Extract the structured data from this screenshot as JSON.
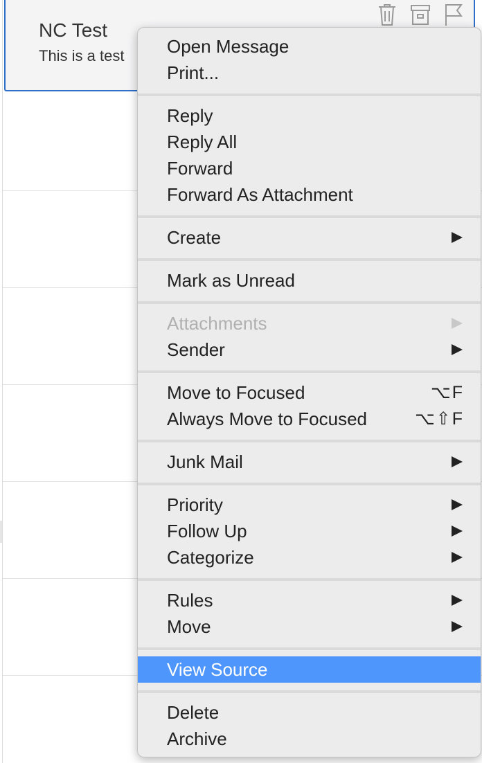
{
  "message": {
    "sender": "NC Test",
    "preview": "This is a test",
    "actions": [
      "trash-icon",
      "archive-icon",
      "flag-icon"
    ]
  },
  "colors": {
    "highlight": "#4e96fb",
    "selected_border": "#2f6fc9",
    "menu_background": "#ececec",
    "disabled_text": "#b0b0b0"
  },
  "menu": {
    "groups": [
      {
        "items": [
          {
            "label": "Open Message"
          },
          {
            "label": "Print..."
          }
        ]
      },
      {
        "items": [
          {
            "label": "Reply"
          },
          {
            "label": "Reply All"
          },
          {
            "label": "Forward"
          },
          {
            "label": "Forward As Attachment"
          }
        ]
      },
      {
        "items": [
          {
            "label": "Create",
            "submenu": true
          }
        ]
      },
      {
        "items": [
          {
            "label": "Mark as Unread"
          }
        ]
      },
      {
        "items": [
          {
            "label": "Attachments",
            "submenu": true,
            "disabled": true
          },
          {
            "label": "Sender",
            "submenu": true
          }
        ]
      },
      {
        "items": [
          {
            "label": "Move to Focused",
            "shortcut": "⌥F"
          },
          {
            "label": "Always Move to Focused",
            "shortcut": "⌥⇧F"
          }
        ]
      },
      {
        "items": [
          {
            "label": "Junk Mail",
            "submenu": true
          }
        ]
      },
      {
        "items": [
          {
            "label": "Priority",
            "submenu": true
          },
          {
            "label": "Follow Up",
            "submenu": true
          },
          {
            "label": "Categorize",
            "submenu": true
          }
        ]
      },
      {
        "items": [
          {
            "label": "Rules",
            "submenu": true
          },
          {
            "label": "Move",
            "submenu": true
          }
        ]
      },
      {
        "items": [
          {
            "label": "View Source",
            "highlighted": true
          }
        ]
      },
      {
        "items": [
          {
            "label": "Delete"
          },
          {
            "label": "Archive"
          }
        ]
      }
    ]
  }
}
